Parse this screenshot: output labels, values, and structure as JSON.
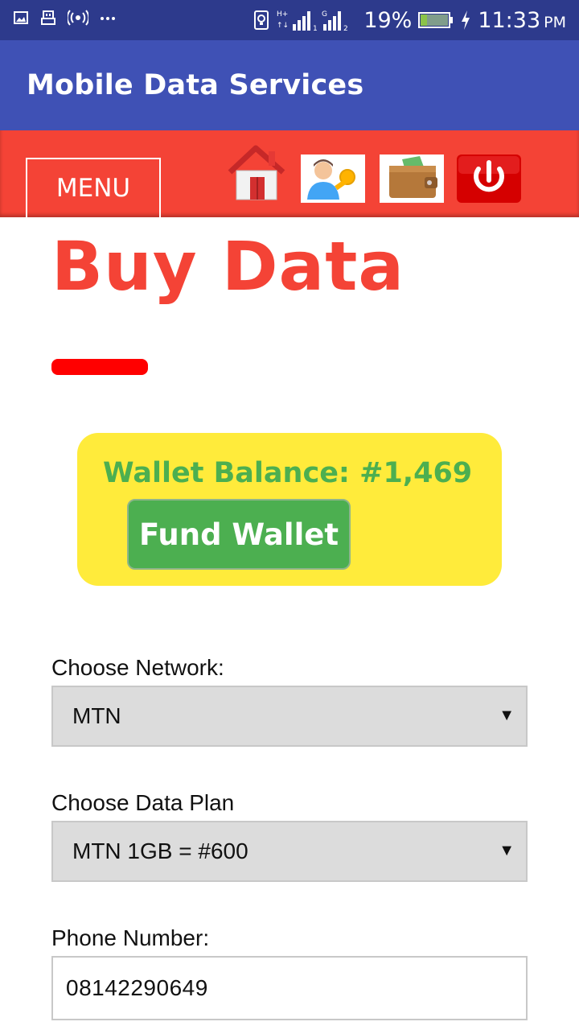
{
  "status_bar": {
    "battery": "19%",
    "time": "11:33",
    "ampm": "PM",
    "sim1_tag": "H+",
    "sim2_tag": "G",
    "icons": [
      "image-icon",
      "usb-icon",
      "hotspot-icon",
      "more-icon",
      "vibrate-icon",
      "signal-icon",
      "battery-icon",
      "charging-icon"
    ]
  },
  "app_bar": {
    "title": "Mobile Data Services"
  },
  "nav": {
    "menu_label": "MENU",
    "icons": [
      "home-icon",
      "profile-key-icon",
      "wallet-icon",
      "power-icon"
    ]
  },
  "main": {
    "heading": "Buy Data",
    "wallet": {
      "balance_text": "Wallet Balance: #1,469",
      "fund_button": "Fund Wallet"
    },
    "network": {
      "label": "Choose Network:",
      "selected": "MTN"
    },
    "plan": {
      "label": "Choose Data Plan",
      "selected": "MTN 1GB = #600"
    },
    "phone": {
      "label": "Phone Number:",
      "value": "08142290649"
    }
  },
  "colors": {
    "status_bar": "#2d3a8c",
    "app_bar": "#3f51b5",
    "nav_bar": "#f44336",
    "heading": "#f44336",
    "wallet_bg": "#ffeb3b",
    "wallet_text": "#4caf50",
    "fund_button": "#4caf50"
  }
}
